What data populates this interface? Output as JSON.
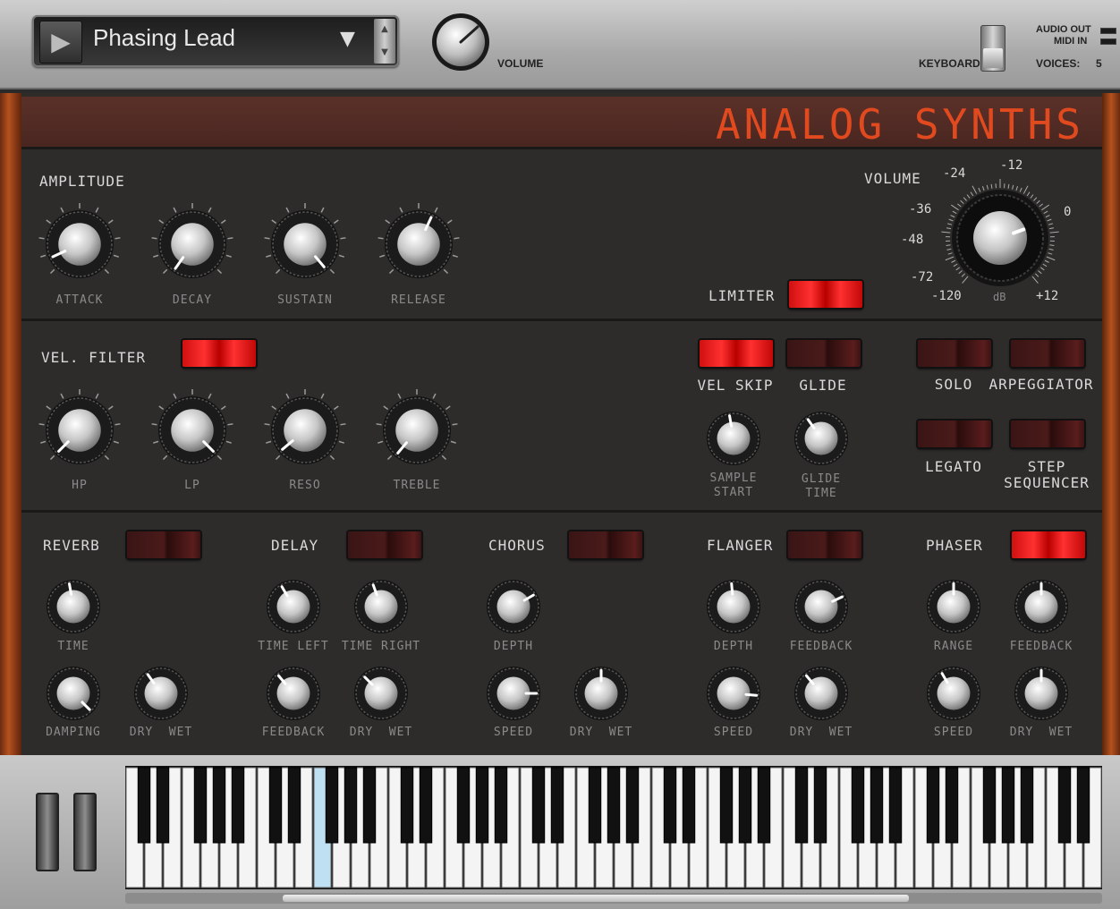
{
  "top": {
    "preset_name": "Phasing Lead",
    "volume_label": "VOLUME",
    "keyboard_label": "KEYBOARD",
    "audio_out": "AUDIO OUT",
    "midi_in": "MIDI IN",
    "voices_label": "VOICES:",
    "voices_value": "5"
  },
  "brand": "ANALOG SYNTHS",
  "amplitude": {
    "title": "AMPLITUDE",
    "knobs": [
      {
        "label": "ATTACK",
        "angle": -115
      },
      {
        "label": "DECAY",
        "angle": -145
      },
      {
        "label": "SUSTAIN",
        "angle": 140
      },
      {
        "label": "RELEASE",
        "angle": 25
      }
    ]
  },
  "master_volume": {
    "title": "VOLUME",
    "unit": "dB",
    "ticks": [
      "-120",
      "-72",
      "-48",
      "-36",
      "-24",
      "-12",
      "0",
      "+12"
    ],
    "angle": 70
  },
  "limiter": {
    "label": "LIMITER",
    "on": true
  },
  "vel_filter": {
    "title": "VEL. FILTER",
    "on": true,
    "knobs": [
      {
        "label": "HP",
        "angle": -135
      },
      {
        "label": "LP",
        "angle": 135
      },
      {
        "label": "RESO",
        "angle": -130
      },
      {
        "label": "TREBLE",
        "angle": -140
      }
    ]
  },
  "voice": {
    "vel_skip": {
      "label": "VEL SKIP",
      "on": true
    },
    "glide": {
      "label": "GLIDE",
      "on": false
    },
    "solo": {
      "label": "SOLO",
      "on": false
    },
    "arpeggiator": {
      "label": "ARPEGGIATOR",
      "on": false
    },
    "legato": {
      "label": "LEGATO",
      "on": false
    },
    "step_seq_1": "STEP",
    "step_seq_2": "SEQUENCER",
    "step_seq_on": false,
    "sample_start_1": "SAMPLE",
    "sample_start_2": "START",
    "glide_time_1": "GLIDE",
    "glide_time_2": "TIME"
  },
  "effects": [
    {
      "title": "REVERB",
      "on": false
    },
    {
      "title": "DELAY",
      "on": false
    },
    {
      "title": "CHORUS",
      "on": false
    },
    {
      "title": "FLANGER",
      "on": false
    },
    {
      "title": "PHASER",
      "on": true
    }
  ],
  "fx_labels": {
    "time": "TIME",
    "damping": "DAMPING",
    "time_left": "TIME LEFT",
    "time_right": "TIME RIGHT",
    "feedback": "FEEDBACK",
    "depth": "DEPTH",
    "speed": "SPEED",
    "range": "RANGE",
    "dry": "DRY",
    "wet": "WET"
  },
  "colors": {
    "accent_red": "#ff2a2a",
    "brand_orange": "#e14a1f",
    "panel": "#2e2c2a"
  }
}
